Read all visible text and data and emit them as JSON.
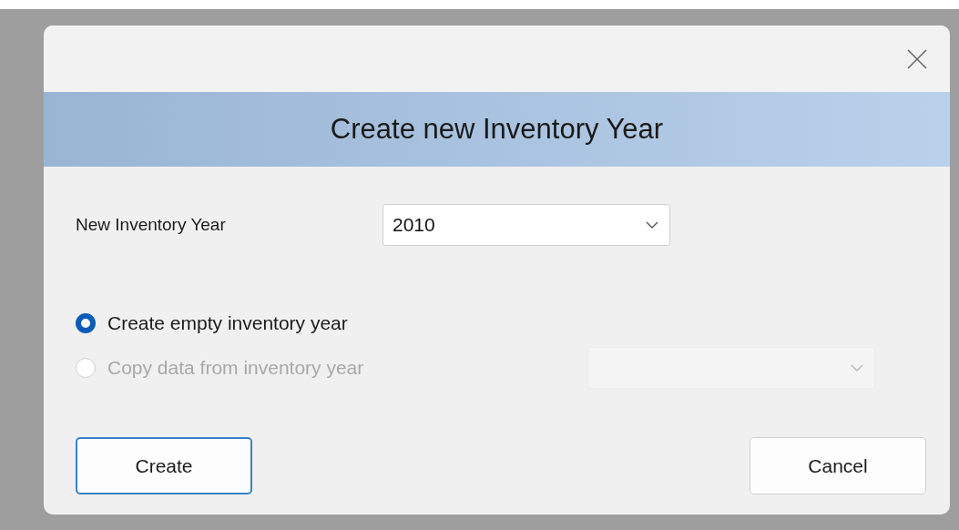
{
  "dialog": {
    "title": "Create new Inventory Year",
    "year_field": {
      "label": "New Inventory Year",
      "value": "2010",
      "disabled": false
    },
    "options": [
      {
        "label": "Create empty inventory year",
        "selected": true,
        "disabled": false,
        "kind": "plain"
      },
      {
        "label": "Copy data from inventory year",
        "selected": false,
        "disabled": true,
        "kind": "with-dropdown",
        "dropdown": {
          "disabled": true
        }
      }
    ],
    "buttons": [
      {
        "label": "Create",
        "default": true
      },
      {
        "label": "Cancel",
        "default": false
      }
    ]
  }
}
